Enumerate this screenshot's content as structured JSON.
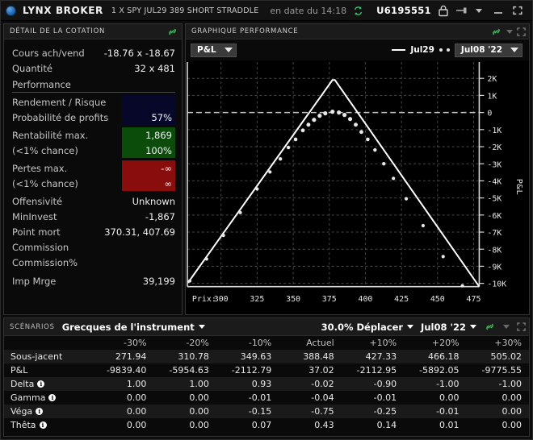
{
  "titlebar": {
    "brand": "LYNX BROKER",
    "contract": "1 X SPY JUL29 389 SHORT STRADDLE",
    "asof": "en date du 14:18",
    "account": "U6195551",
    "icons": {
      "logo": "globe-icon",
      "refresh": "refresh-icon",
      "lock": "lock-icon",
      "pin": "pin-icon",
      "minimize": "minimize-icon",
      "maximize": "maximize-icon",
      "close": "close-icon"
    }
  },
  "quote_panel": {
    "title": "Détail de la cotation",
    "rows": [
      {
        "label": "Cours ach/vend",
        "value": "-18.76 x -18.67"
      },
      {
        "label": "Quantité",
        "value": "32 x 481"
      }
    ],
    "section": "Performance",
    "perf": [
      {
        "label": "Rendement / Risque",
        "value": "",
        "style": "navy"
      },
      {
        "label": "Probabilité de profits",
        "value": "57%",
        "style": "navy"
      },
      {
        "label": "Rentabilité max.",
        "value": "1,869",
        "style": "green"
      },
      {
        "label": "(<1% chance)",
        "value": "100%",
        "style": "green"
      },
      {
        "label": "Pertes max.",
        "value": "-∞",
        "style": "red"
      },
      {
        "label": "(<1% chance)",
        "value": "∞",
        "style": "red"
      }
    ],
    "plain": [
      {
        "label": "Offensivité",
        "value": "Unknown"
      },
      {
        "label": "MinInvest",
        "value": "-1,867"
      },
      {
        "label": "Point mort",
        "value": "370.31, 407.69"
      },
      {
        "label": "Commission",
        "value": ""
      },
      {
        "label": "Commission%",
        "value": ""
      },
      {
        "label": "Imp Mrge",
        "value": "39,199"
      }
    ]
  },
  "chart_panel": {
    "title": "Graphique performance",
    "mode_dropdown": "P&L",
    "legend_line": "Jul29",
    "date_dropdown": "Jul08 '22"
  },
  "scenarios": {
    "tab": "Scénarios",
    "selector": "Grecques de l'instrument",
    "move": "30.0% Déplacer",
    "date": "Jul08 '22",
    "columns": [
      "",
      "-30%",
      "-20%",
      "-10%",
      "Actuel",
      "+10%",
      "+20%",
      "+30%"
    ],
    "rows": [
      {
        "label": "Sous-jacent",
        "info": false,
        "values": [
          "271.94",
          "310.78",
          "349.63",
          "388.48",
          "427.33",
          "466.18",
          "505.02"
        ]
      },
      {
        "label": "P&L",
        "info": false,
        "values": [
          "-9839.40",
          "-5954.63",
          "-2112.79",
          "37.02",
          "-2112.95",
          "-5892.05",
          "-9775.55"
        ]
      },
      {
        "label": "Delta",
        "info": true,
        "values": [
          "1.00",
          "1.00",
          "0.93",
          "-0.02",
          "-0.90",
          "-1.00",
          "-1.00"
        ]
      },
      {
        "label": "Gamma",
        "info": true,
        "values": [
          "0.00",
          "0.00",
          "-0.01",
          "-0.04",
          "-0.01",
          "0.00",
          "0.00"
        ]
      },
      {
        "label": "Véga",
        "info": true,
        "values": [
          "0.00",
          "0.00",
          "-0.15",
          "-0.75",
          "-0.25",
          "-0.01",
          "0.00"
        ]
      },
      {
        "label": "Thêta",
        "info": true,
        "values": [
          "0.00",
          "0.00",
          "0.07",
          "0.43",
          "0.14",
          "0.01",
          "0.00"
        ]
      }
    ]
  },
  "chart_data": {
    "type": "line",
    "title": "",
    "xlabel": "Prix:",
    "ylabel": "P&L",
    "xlim": [
      288,
      492
    ],
    "ylim": [
      -10500,
      2400
    ],
    "xticks": [
      300,
      325,
      350,
      375,
      400,
      425,
      450,
      475
    ],
    "yticks": [
      2000,
      1000,
      0,
      -1000,
      -2000,
      -3000,
      -4000,
      -5000,
      -6000,
      -7000,
      -8000,
      -9000,
      -10000
    ],
    "ytick_labels": [
      "2K",
      "1K",
      "0",
      "-1K",
      "-2K",
      "-3K",
      "-4K",
      "-5K",
      "-6K",
      "-7K",
      "-8K",
      "-9K",
      "-10K"
    ],
    "grid": true,
    "zero_line": 0,
    "legend_position": "top-right",
    "series": [
      {
        "name": "Jul29",
        "style": "solid",
        "x": [
          288,
          389,
          492
        ],
        "values": [
          -9940,
          1869,
          -10400
        ]
      },
      {
        "name": "Jul08 '22",
        "style": "dotted",
        "x": [
          288,
          300,
          312,
          324,
          336,
          345,
          352,
          358,
          363,
          368,
          372,
          376,
          380,
          384,
          389,
          393,
          397,
          401,
          405,
          409,
          413,
          418,
          424,
          431,
          440,
          452,
          466,
          480,
          492
        ],
        "values": [
          -9940,
          -8660,
          -7290,
          -5960,
          -4590,
          -3580,
          -2830,
          -2180,
          -1670,
          -1180,
          -820,
          -500,
          -250,
          -80,
          37,
          -30,
          -180,
          -420,
          -740,
          -1130,
          -1570,
          -2180,
          -2960,
          -3860,
          -5030,
          -6590,
          -8390,
          -10120,
          -10400
        ]
      }
    ]
  }
}
